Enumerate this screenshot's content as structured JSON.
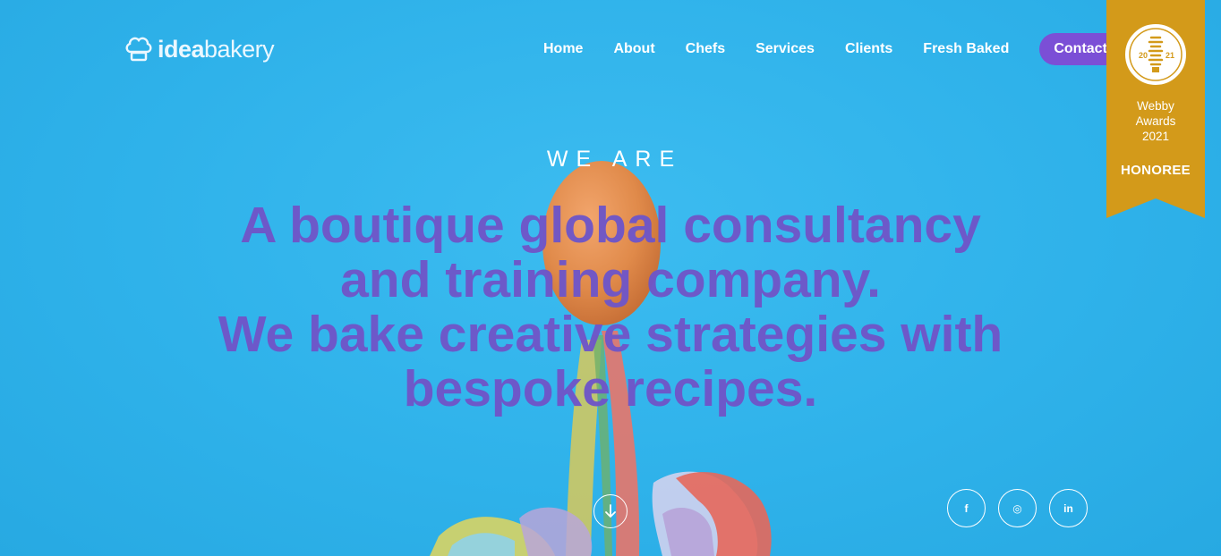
{
  "brand": {
    "logo_bold": "idea",
    "logo_light": "bakery",
    "logo_icon": "chef-hat-icon"
  },
  "nav": {
    "items": [
      {
        "label": "Home"
      },
      {
        "label": "About"
      },
      {
        "label": "Chefs"
      },
      {
        "label": "Services"
      },
      {
        "label": "Clients"
      },
      {
        "label": "Fresh Baked"
      }
    ],
    "contact_label": "Contact"
  },
  "award": {
    "year_left": "20",
    "year_right": "21",
    "name_line1": "Webby",
    "name_line2": "Awards",
    "name_line3": "2021",
    "status": "HONOREE",
    "color": "#d39a1a"
  },
  "hero": {
    "eyebrow": "WE ARE",
    "headline_lines": [
      "A boutique global consultancy",
      "and training company.",
      "We bake creative strategies with",
      "bespoke recipes."
    ],
    "headline_color": "#6f56c8",
    "background_color": "#2fb2ea"
  },
  "scroll": {
    "icon": "arrow-down-icon"
  },
  "social": [
    {
      "label": "f",
      "icon": "facebook-icon"
    },
    {
      "label": "◎",
      "icon": "instagram-icon"
    },
    {
      "label": "in",
      "icon": "linkedin-icon"
    }
  ]
}
